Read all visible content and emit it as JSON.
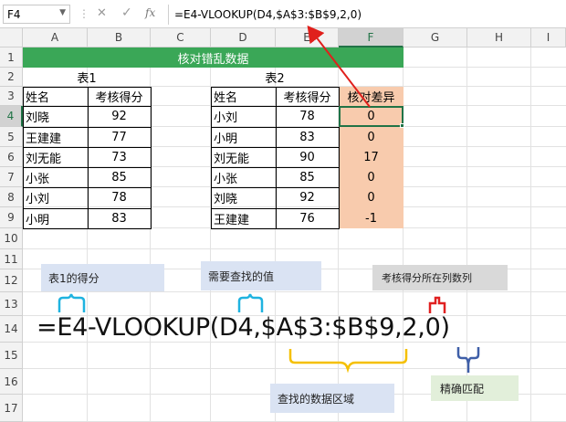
{
  "formula_bar": {
    "name_box": "F4",
    "cancel_icon": "✕",
    "enter_icon": "✓",
    "fx_label": "fx",
    "formula": "=E4-VLOOKUP(D4,$A$3:$B$9,2,0)"
  },
  "columns": [
    "A",
    "B",
    "C",
    "D",
    "E",
    "F",
    "G",
    "H",
    "I"
  ],
  "rows": [
    "1",
    "2",
    "3",
    "4",
    "5",
    "6",
    "7",
    "8",
    "9",
    "10",
    "11",
    "12",
    "13",
    "14",
    "15",
    "16",
    "17"
  ],
  "banner": "核对错乱数据",
  "table1": {
    "title": "表1",
    "headers": [
      "姓名",
      "考核得分"
    ],
    "rows": [
      [
        "刘晓",
        "92"
      ],
      [
        "王建建",
        "77"
      ],
      [
        "刘无能",
        "73"
      ],
      [
        "小张",
        "85"
      ],
      [
        "小刘",
        "78"
      ],
      [
        "小明",
        "83"
      ]
    ]
  },
  "table2": {
    "title": "表2",
    "headers": [
      "姓名",
      "考核得分",
      "核对差异"
    ],
    "rows": [
      [
        "小刘",
        "78",
        "0"
      ],
      [
        "小明",
        "83",
        "0"
      ],
      [
        "刘无能",
        "90",
        "17"
      ],
      [
        "小张",
        "85",
        "0"
      ],
      [
        "刘晓",
        "92",
        "0"
      ],
      [
        "王建建",
        "76",
        "-1"
      ]
    ]
  },
  "annotations": {
    "formula_big": "=E4-VLOOKUP(D4,$A$3:$B$9,2,0)",
    "note_table1_score": "表1的得分",
    "note_lookup_value": "需要查找的值",
    "note_column_index": "考核得分所在列数列",
    "note_lookup_range": "查找的数据区域",
    "note_exact_match": "精确匹配"
  },
  "colors": {
    "banner_green": "#3aa757",
    "diff_fill": "#f8cbad",
    "note_blue": "#dae3f3",
    "note_gray": "#d9d9d9",
    "note_green": "#e2efda",
    "brace_cyan": "#1fb3e0",
    "brace_red": "#e02020",
    "brace_yellow": "#f5c000",
    "brace_navy": "#3f5fa8",
    "arrow_red": "#e0201c",
    "select_green": "#217346"
  }
}
